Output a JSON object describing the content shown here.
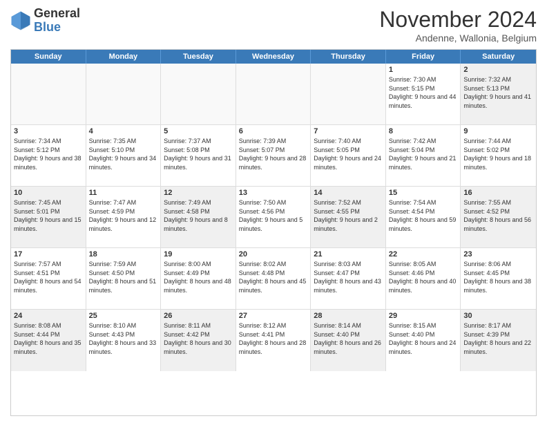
{
  "logo": {
    "line1": "General",
    "line2": "Blue"
  },
  "title": "November 2024",
  "subtitle": "Andenne, Wallonia, Belgium",
  "header": {
    "days": [
      "Sunday",
      "Monday",
      "Tuesday",
      "Wednesday",
      "Thursday",
      "Friday",
      "Saturday"
    ]
  },
  "weeks": [
    {
      "cells": [
        {
          "day": "",
          "empty": true
        },
        {
          "day": "",
          "empty": true
        },
        {
          "day": "",
          "empty": true
        },
        {
          "day": "",
          "empty": true
        },
        {
          "day": "",
          "empty": true
        },
        {
          "day": "1",
          "sunrise": "Sunrise: 7:30 AM",
          "sunset": "Sunset: 5:15 PM",
          "daylight": "Daylight: 9 hours and 44 minutes."
        },
        {
          "day": "2",
          "sunrise": "Sunrise: 7:32 AM",
          "sunset": "Sunset: 5:13 PM",
          "daylight": "Daylight: 9 hours and 41 minutes."
        }
      ]
    },
    {
      "cells": [
        {
          "day": "3",
          "sunrise": "Sunrise: 7:34 AM",
          "sunset": "Sunset: 5:12 PM",
          "daylight": "Daylight: 9 hours and 38 minutes."
        },
        {
          "day": "4",
          "sunrise": "Sunrise: 7:35 AM",
          "sunset": "Sunset: 5:10 PM",
          "daylight": "Daylight: 9 hours and 34 minutes."
        },
        {
          "day": "5",
          "sunrise": "Sunrise: 7:37 AM",
          "sunset": "Sunset: 5:08 PM",
          "daylight": "Daylight: 9 hours and 31 minutes."
        },
        {
          "day": "6",
          "sunrise": "Sunrise: 7:39 AM",
          "sunset": "Sunset: 5:07 PM",
          "daylight": "Daylight: 9 hours and 28 minutes."
        },
        {
          "day": "7",
          "sunrise": "Sunrise: 7:40 AM",
          "sunset": "Sunset: 5:05 PM",
          "daylight": "Daylight: 9 hours and 24 minutes."
        },
        {
          "day": "8",
          "sunrise": "Sunrise: 7:42 AM",
          "sunset": "Sunset: 5:04 PM",
          "daylight": "Daylight: 9 hours and 21 minutes."
        },
        {
          "day": "9",
          "sunrise": "Sunrise: 7:44 AM",
          "sunset": "Sunset: 5:02 PM",
          "daylight": "Daylight: 9 hours and 18 minutes."
        }
      ]
    },
    {
      "cells": [
        {
          "day": "10",
          "sunrise": "Sunrise: 7:45 AM",
          "sunset": "Sunset: 5:01 PM",
          "daylight": "Daylight: 9 hours and 15 minutes."
        },
        {
          "day": "11",
          "sunrise": "Sunrise: 7:47 AM",
          "sunset": "Sunset: 4:59 PM",
          "daylight": "Daylight: 9 hours and 12 minutes."
        },
        {
          "day": "12",
          "sunrise": "Sunrise: 7:49 AM",
          "sunset": "Sunset: 4:58 PM",
          "daylight": "Daylight: 9 hours and 8 minutes."
        },
        {
          "day": "13",
          "sunrise": "Sunrise: 7:50 AM",
          "sunset": "Sunset: 4:56 PM",
          "daylight": "Daylight: 9 hours and 5 minutes."
        },
        {
          "day": "14",
          "sunrise": "Sunrise: 7:52 AM",
          "sunset": "Sunset: 4:55 PM",
          "daylight": "Daylight: 9 hours and 2 minutes."
        },
        {
          "day": "15",
          "sunrise": "Sunrise: 7:54 AM",
          "sunset": "Sunset: 4:54 PM",
          "daylight": "Daylight: 8 hours and 59 minutes."
        },
        {
          "day": "16",
          "sunrise": "Sunrise: 7:55 AM",
          "sunset": "Sunset: 4:52 PM",
          "daylight": "Daylight: 8 hours and 56 minutes."
        }
      ]
    },
    {
      "cells": [
        {
          "day": "17",
          "sunrise": "Sunrise: 7:57 AM",
          "sunset": "Sunset: 4:51 PM",
          "daylight": "Daylight: 8 hours and 54 minutes."
        },
        {
          "day": "18",
          "sunrise": "Sunrise: 7:59 AM",
          "sunset": "Sunset: 4:50 PM",
          "daylight": "Daylight: 8 hours and 51 minutes."
        },
        {
          "day": "19",
          "sunrise": "Sunrise: 8:00 AM",
          "sunset": "Sunset: 4:49 PM",
          "daylight": "Daylight: 8 hours and 48 minutes."
        },
        {
          "day": "20",
          "sunrise": "Sunrise: 8:02 AM",
          "sunset": "Sunset: 4:48 PM",
          "daylight": "Daylight: 8 hours and 45 minutes."
        },
        {
          "day": "21",
          "sunrise": "Sunrise: 8:03 AM",
          "sunset": "Sunset: 4:47 PM",
          "daylight": "Daylight: 8 hours and 43 minutes."
        },
        {
          "day": "22",
          "sunrise": "Sunrise: 8:05 AM",
          "sunset": "Sunset: 4:46 PM",
          "daylight": "Daylight: 8 hours and 40 minutes."
        },
        {
          "day": "23",
          "sunrise": "Sunrise: 8:06 AM",
          "sunset": "Sunset: 4:45 PM",
          "daylight": "Daylight: 8 hours and 38 minutes."
        }
      ]
    },
    {
      "cells": [
        {
          "day": "24",
          "sunrise": "Sunrise: 8:08 AM",
          "sunset": "Sunset: 4:44 PM",
          "daylight": "Daylight: 8 hours and 35 minutes."
        },
        {
          "day": "25",
          "sunrise": "Sunrise: 8:10 AM",
          "sunset": "Sunset: 4:43 PM",
          "daylight": "Daylight: 8 hours and 33 minutes."
        },
        {
          "day": "26",
          "sunrise": "Sunrise: 8:11 AM",
          "sunset": "Sunset: 4:42 PM",
          "daylight": "Daylight: 8 hours and 30 minutes."
        },
        {
          "day": "27",
          "sunrise": "Sunrise: 8:12 AM",
          "sunset": "Sunset: 4:41 PM",
          "daylight": "Daylight: 8 hours and 28 minutes."
        },
        {
          "day": "28",
          "sunrise": "Sunrise: 8:14 AM",
          "sunset": "Sunset: 4:40 PM",
          "daylight": "Daylight: 8 hours and 26 minutes."
        },
        {
          "day": "29",
          "sunrise": "Sunrise: 8:15 AM",
          "sunset": "Sunset: 4:40 PM",
          "daylight": "Daylight: 8 hours and 24 minutes."
        },
        {
          "day": "30",
          "sunrise": "Sunrise: 8:17 AM",
          "sunset": "Sunset: 4:39 PM",
          "daylight": "Daylight: 8 hours and 22 minutes."
        }
      ]
    }
  ]
}
